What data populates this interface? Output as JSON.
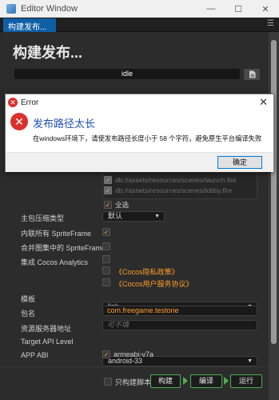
{
  "window": {
    "title": "Editor Window"
  },
  "tab": {
    "label": "构建发布..."
  },
  "panel": {
    "heading": "构建发布...",
    "status": "idle"
  },
  "dialog": {
    "title": "Error",
    "heading": "发布路径太长",
    "message": "在windows环境下，请使发布路径长度小于 58 个字符，避免原生平台编译失败",
    "ok_label": "确定"
  },
  "scenes": [
    {
      "path": "db://assets/resources/scenes/launch.fire"
    },
    {
      "path": "db://assets/resources/scenes/lobby.fire"
    }
  ],
  "select_all_label": "全选",
  "form": {
    "compression_label": "主包压缩类型",
    "compression_value": "默认",
    "inline_spriteframe_label": "内联所有 SpriteFrame",
    "merge_spriteframe_label": "合并图集中的 SpriteFrame",
    "analytics_label": "集成 Cocos Analytics",
    "privacy_link": "《Cocos隐私政策》",
    "service_link": "《Cocos用户服务协议》",
    "template_label": "模板",
    "template_value": "link",
    "package_label": "包名",
    "package_value": "com.freegame.testone",
    "resource_server_label": "资源服务器地址",
    "resource_server_placeholder": "可不填",
    "api_level_label": "Target API Level",
    "api_level_value": "android-33",
    "app_abi_label": "APP ABI",
    "app_abi_value": "armeabi-v7a"
  },
  "bottom": {
    "only_build_script_label": "只构建脚本",
    "build_label": "构建",
    "compile_label": "编译",
    "run_label": "运行"
  },
  "colors": {
    "accent_orange": "#ff9d2a",
    "tab_blue": "#0f5fa6",
    "build_green": "#4caf50",
    "error_red": "#d9312b"
  }
}
